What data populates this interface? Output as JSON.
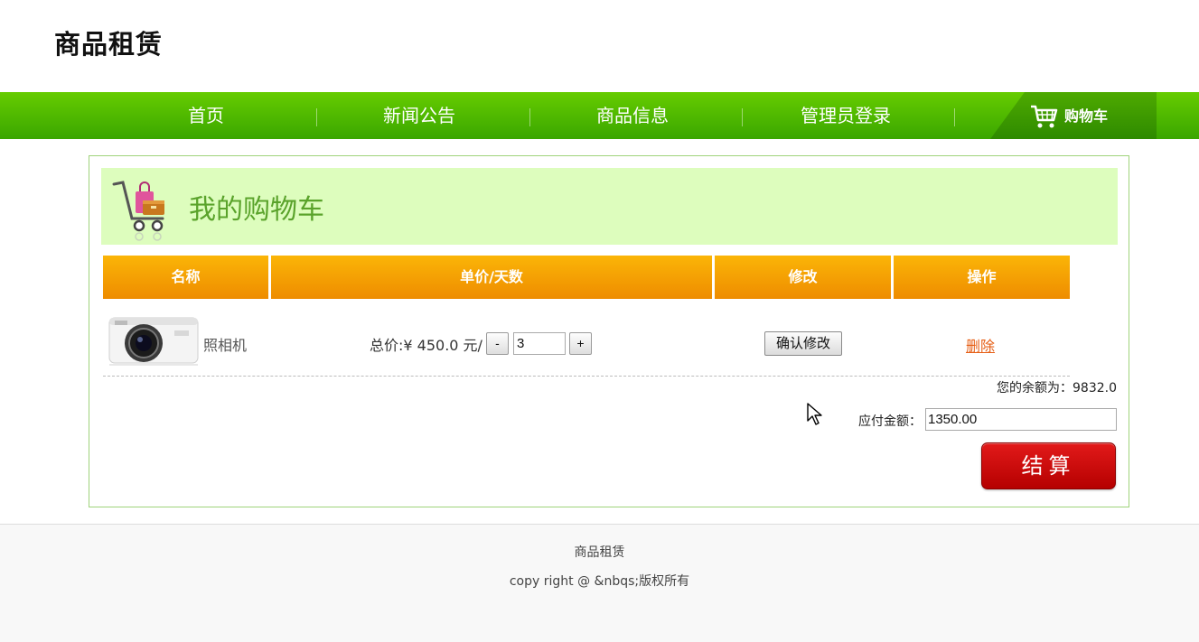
{
  "site": {
    "title": "商品租赁"
  },
  "nav": {
    "items": [
      {
        "label": "首页"
      },
      {
        "label": "新闻公告"
      },
      {
        "label": "商品信息"
      },
      {
        "label": "管理员登录"
      }
    ],
    "cart_label": "购物车"
  },
  "cart": {
    "title": "我的购物车",
    "columns": [
      "名称",
      "单价/天数",
      "修改",
      "操作"
    ],
    "item": {
      "name": "照相机",
      "price_text": "总价:¥ 450.0 元/",
      "decrement_label": "-",
      "quantity": "3",
      "increment_label": "+",
      "confirm_label": "确认修改",
      "delete_label": "删除"
    },
    "balance_text": "您的余额为：9832.0",
    "payable_label": "应付金额：",
    "payable_value": "1350.00",
    "checkout_label": "结算"
  },
  "footer": {
    "name": "商品租赁",
    "copyright": "copy right @ &nbqs;版权所有"
  },
  "colors": {
    "nav_green": "#4db800",
    "header_bg": "#ddfdbd",
    "table_header_orange": "#f5a000",
    "checkout_red": "#cc0000",
    "delete_link": "#e65f16"
  }
}
